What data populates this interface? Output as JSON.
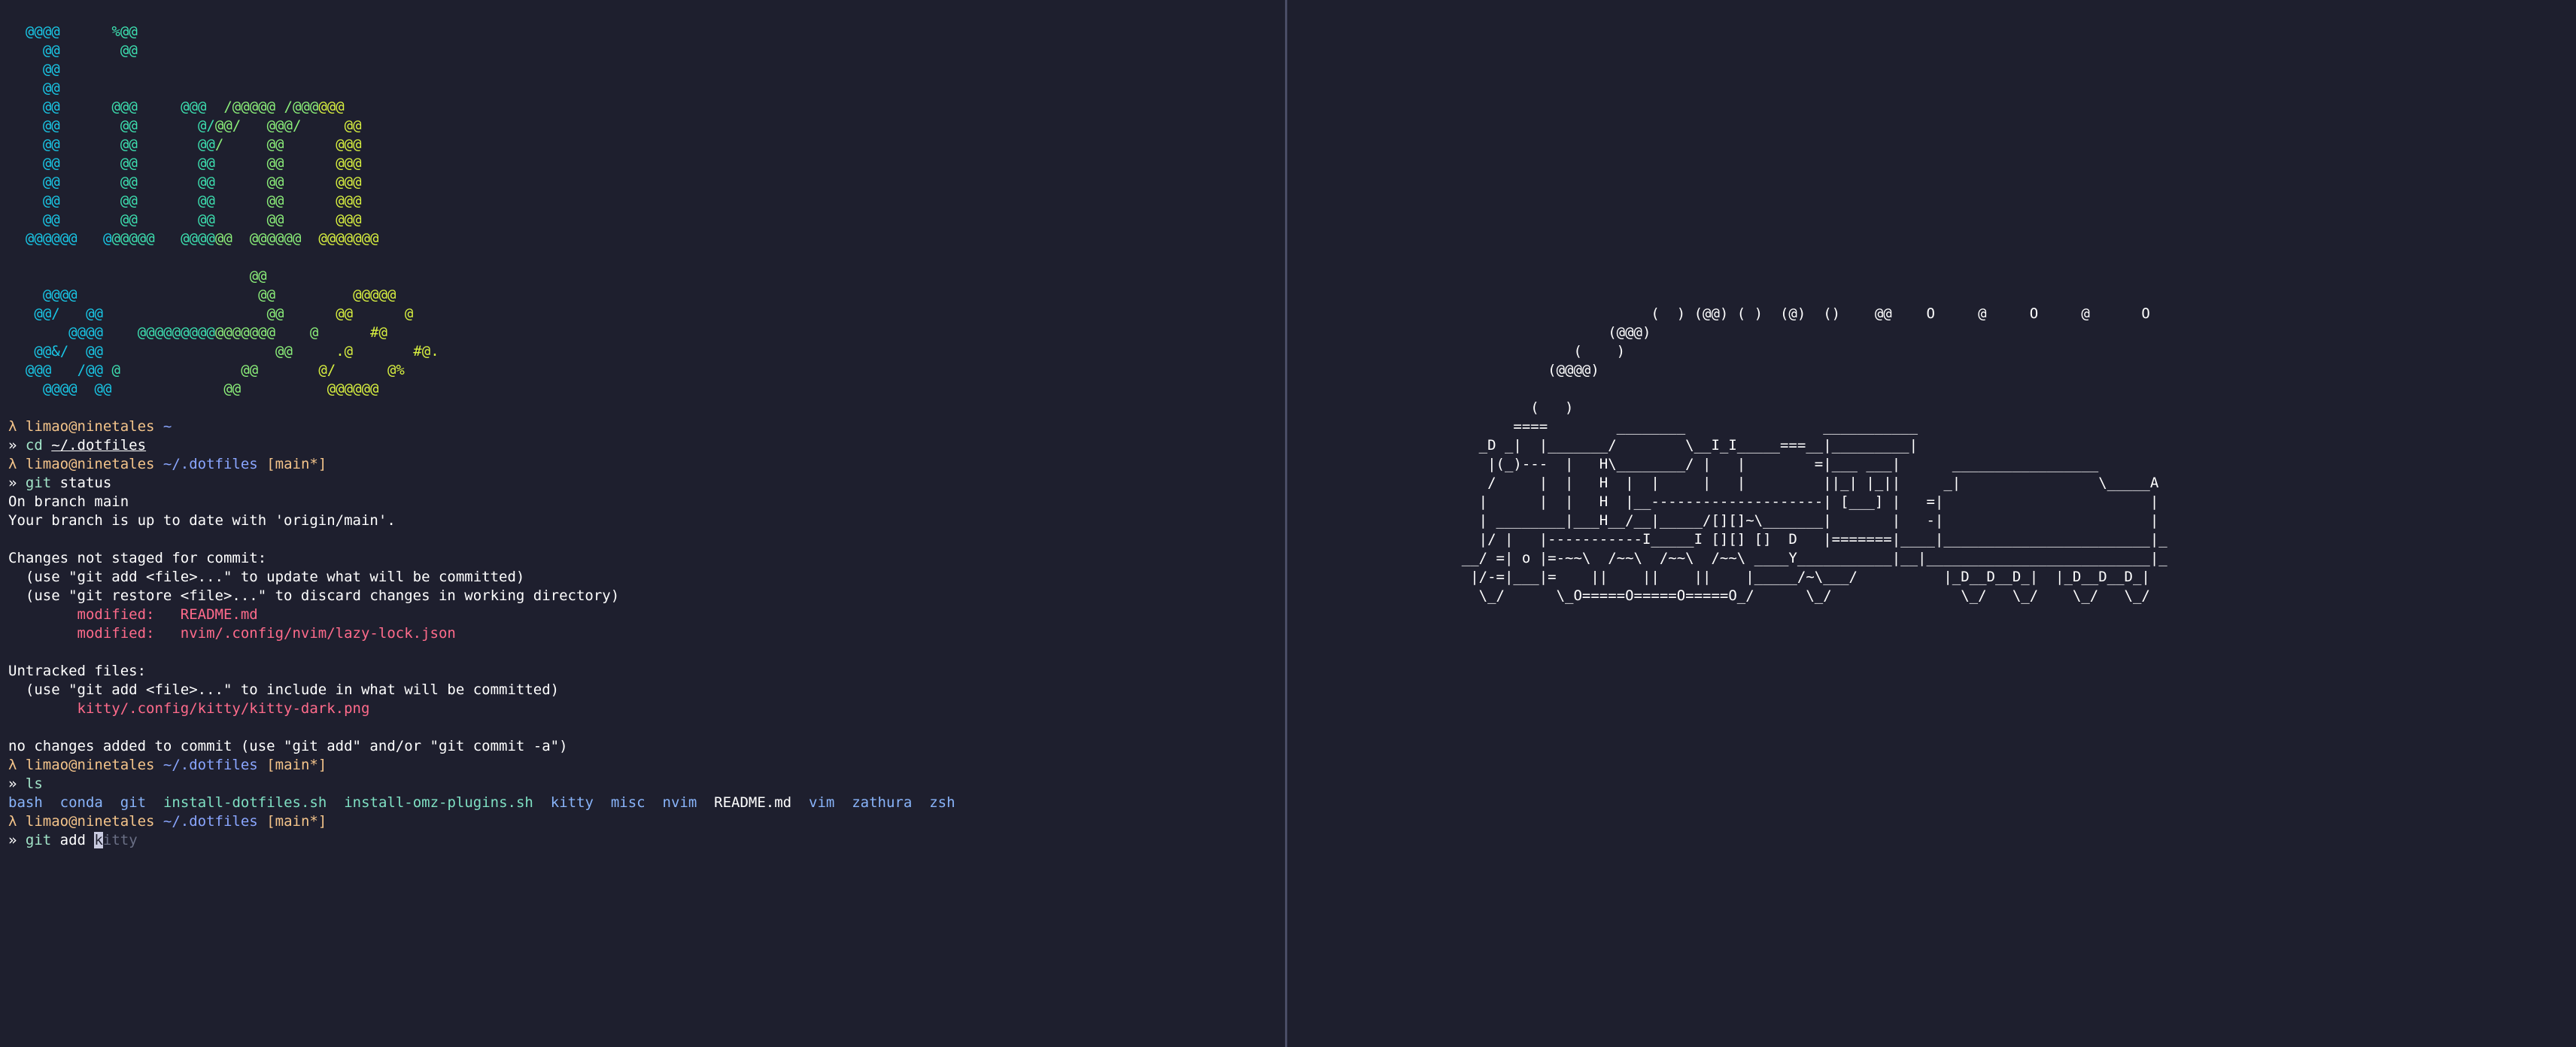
{
  "logo_rows": [
    "  @@@@      %@@",
    "    @@       @@",
    "    @@",
    "    @@",
    "    @@      @@@     @@@  /@@@@@ /@@@@@@",
    "    @@       @@       @/@@/   @@@/     @@",
    "    @@       @@       @@/     @@      @@@",
    "    @@       @@       @@      @@      @@@",
    "    @@       @@       @@      @@      @@@",
    "    @@       @@       @@      @@      @@@",
    "    @@       @@       @@      @@      @@@",
    "  @@@@@@   @@@@@@   @@@@@@  @@@@@@  @@@@@@@",
    "",
    "                            @@",
    "    @@@@                     @@         @@@@@",
    "   @@/   @@                   @@      @@      @",
    "       @@@@    @@@@@@@@@@@@@@@@    @      #@",
    "   @@&/  @@                    @@     .@       #@.",
    "  @@@   /@@ @              @@       @/      @%",
    "    @@@@  @@             @@          @@@@@@"
  ],
  "logo_colors": [
    "#19c7e6",
    "#3de0b0",
    "#8cf07a",
    "#d8f040"
  ],
  "terminal": {
    "prompt_user": "λ limao@ninetales",
    "lines": [
      {
        "type": "prompt",
        "path": "~",
        "branch": ""
      },
      {
        "type": "cmd",
        "cmd": "cd",
        "arg": "~/.dotfiles"
      },
      {
        "type": "prompt",
        "path": "~/.dotfiles",
        "branch": "[main*]"
      },
      {
        "type": "cmd",
        "cmd": "git",
        "arg": "status"
      },
      {
        "type": "text",
        "text": "On branch main"
      },
      {
        "type": "text",
        "text": "Your branch is up to date with 'origin/main'."
      },
      {
        "type": "text",
        "text": ""
      },
      {
        "type": "text",
        "text": "Changes not staged for commit:"
      },
      {
        "type": "text",
        "text": "  (use \"git add <file>...\" to update what will be committed)"
      },
      {
        "type": "text",
        "text": "  (use \"git restore <file>...\" to discard changes in working directory)"
      },
      {
        "type": "mod",
        "text": "        modified:   README.md"
      },
      {
        "type": "mod",
        "text": "        modified:   nvim/.config/nvim/lazy-lock.json"
      },
      {
        "type": "text",
        "text": ""
      },
      {
        "type": "text",
        "text": "Untracked files:"
      },
      {
        "type": "text",
        "text": "  (use \"git add <file>...\" to include in what will be committed)"
      },
      {
        "type": "mod",
        "text": "        kitty/.config/kitty/kitty-dark.png"
      },
      {
        "type": "text",
        "text": ""
      },
      {
        "type": "text",
        "text": "no changes added to commit (use \"git add\" and/or \"git commit -a\")"
      },
      {
        "type": "prompt",
        "path": "~/.dotfiles",
        "branch": "[main*]"
      },
      {
        "type": "cmd",
        "cmd": "ls",
        "arg": ""
      },
      {
        "type": "ls"
      },
      {
        "type": "prompt",
        "path": "~/.dotfiles",
        "branch": "[main*]"
      },
      {
        "type": "input",
        "cmd": "git",
        "arg": "add",
        "cursor": "k",
        "suggest": "itty"
      }
    ],
    "cmd_prefix": "»",
    "ls_items": [
      {
        "name": "bash",
        "kind": "dir"
      },
      {
        "name": "conda",
        "kind": "dir"
      },
      {
        "name": "git",
        "kind": "dir"
      },
      {
        "name": "install-dotfiles.sh",
        "kind": "exec"
      },
      {
        "name": "install-omz-plugins.sh",
        "kind": "exec"
      },
      {
        "name": "kitty",
        "kind": "dir"
      },
      {
        "name": "misc",
        "kind": "dir"
      },
      {
        "name": "nvim",
        "kind": "dir"
      },
      {
        "name": "README.md",
        "kind": "file"
      },
      {
        "name": "vim",
        "kind": "dir"
      },
      {
        "name": "zathura",
        "kind": "dir"
      },
      {
        "name": "zsh",
        "kind": "dir"
      }
    ]
  },
  "train_rows": [
    "                          (  ) (@@) ( )  (@)  ()    @@    O     @     O     @      O",
    "                     (@@@)",
    "                 (    )",
    "              (@@@@)",
    "",
    "            (   )",
    "          ====        ________                ___________",
    "      _D _|  |_______/        \\__I_I_____===__|_________|",
    "       |(_)---  |   H\\________/ |   |        =|___ ___|      _________________",
    "       /     |  |   H  |  |     |   |         ||_| |_||     _|                \\_____A",
    "      |      |  |   H  |__--------------------| [___] |   =|                        |",
    "      | ________|___H__/__|_____/[][]~\\_______|       |   -|                        |",
    "      |/ |   |-----------I_____I [][] []  D   |=======|____|________________________|_",
    "    __/ =| o |=-~~\\  /~~\\  /~~\\  /~~\\ ____Y___________|__|__________________________|_",
    "     |/-=|___|=    ||    ||    ||    |_____/~\\___/          |_D__D__D_|  |_D__D__D_|",
    "      \\_/      \\_O=====O=====O=====O_/      \\_/               \\_/   \\_/    \\_/   \\_/"
  ]
}
